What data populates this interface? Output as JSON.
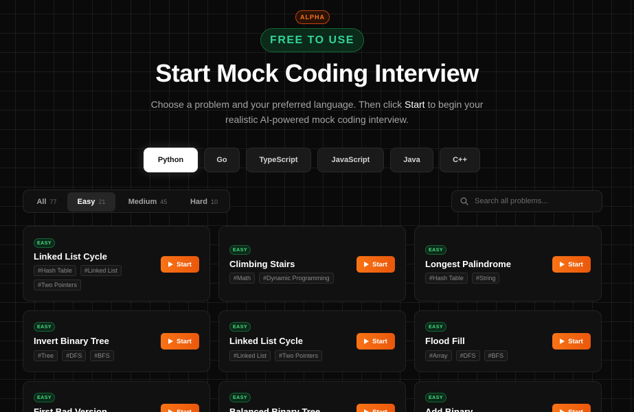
{
  "header": {
    "alpha_badge": "ALPHA",
    "free_badge": "FREE TO USE",
    "title": "Start Mock Coding Interview",
    "subtitle_before": "Choose a problem and your preferred language. Then click ",
    "subtitle_highlight": "Start",
    "subtitle_after": " to begin your realistic AI-powered mock coding interview."
  },
  "languages": [
    {
      "label": "Python",
      "active": true
    },
    {
      "label": "Go",
      "active": false
    },
    {
      "label": "TypeScript",
      "active": false
    },
    {
      "label": "JavaScript",
      "active": false
    },
    {
      "label": "Java",
      "active": false
    },
    {
      "label": "C++",
      "active": false
    }
  ],
  "difficulty_filters": [
    {
      "label": "All",
      "count": "77",
      "active": false
    },
    {
      "label": "Easy",
      "count": "21",
      "active": true
    },
    {
      "label": "Medium",
      "count": "45",
      "active": false
    },
    {
      "label": "Hard",
      "count": "10",
      "active": false
    }
  ],
  "search": {
    "placeholder": "Search all problems..."
  },
  "start_label": "Start",
  "problems": [
    {
      "difficulty": "EASY",
      "name": "Linked List Cycle",
      "tags": [
        "#Hash Table",
        "#Linked List",
        "#Two Pointers"
      ]
    },
    {
      "difficulty": "EASY",
      "name": "Climbing Stairs",
      "tags": [
        "#Math",
        "#Dynamic Programming"
      ]
    },
    {
      "difficulty": "EASY",
      "name": "Longest Palindrome",
      "tags": [
        "#Hash Table",
        "#String"
      ]
    },
    {
      "difficulty": "EASY",
      "name": "Invert Binary Tree",
      "tags": [
        "#Tree",
        "#DFS",
        "#BFS"
      ]
    },
    {
      "difficulty": "EASY",
      "name": "Linked List Cycle",
      "tags": [
        "#Linked List",
        "#Two Pointers"
      ]
    },
    {
      "difficulty": "EASY",
      "name": "Flood Fill",
      "tags": [
        "#Array",
        "#DFS",
        "#BFS"
      ]
    },
    {
      "difficulty": "EASY",
      "name": "First Bad Version",
      "tags": []
    },
    {
      "difficulty": "EASY",
      "name": "Balanced Binary Tree",
      "tags": []
    },
    {
      "difficulty": "EASY",
      "name": "Add Binary",
      "tags": []
    }
  ],
  "colors": {
    "accent": "#f97316",
    "easy": "#4ade80",
    "background": "#0a0a0a"
  }
}
